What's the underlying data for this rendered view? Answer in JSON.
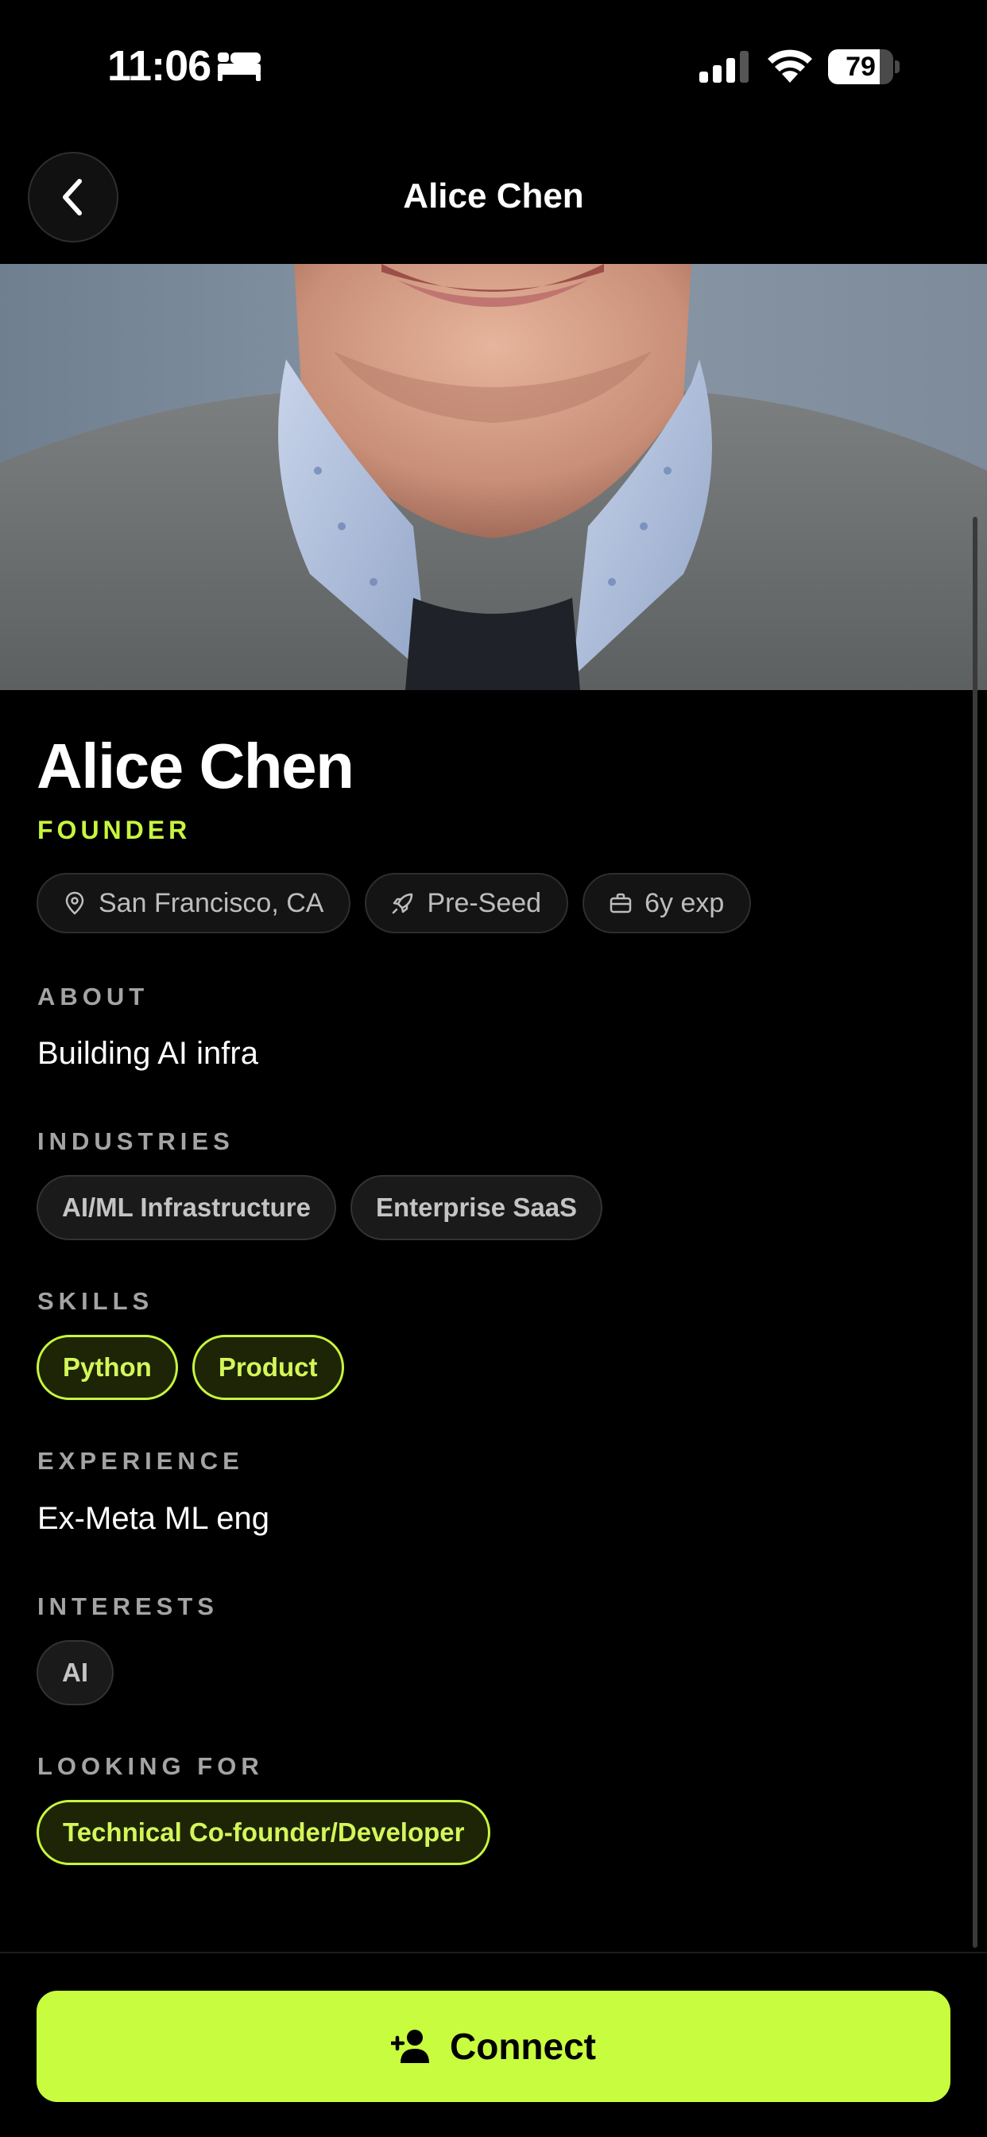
{
  "status_bar": {
    "time": "11:06",
    "battery": "79",
    "battery_level": 0.79,
    "icons": [
      "sleep-focus-icon",
      "cellular-signal-icon",
      "wifi-icon",
      "battery-icon"
    ]
  },
  "nav": {
    "title": "Alice Chen",
    "back_icon": "chevron-left-icon"
  },
  "profile": {
    "name": "Alice Chen",
    "role": "FOUNDER",
    "meta": [
      {
        "icon": "location-pin-icon",
        "label": "San Francisco, CA"
      },
      {
        "icon": "rocket-icon",
        "label": "Pre-Seed"
      },
      {
        "icon": "briefcase-icon",
        "label": "6y exp"
      }
    ],
    "about": {
      "label": "ABOUT",
      "text": "Building AI infra"
    },
    "industries": {
      "label": "INDUSTRIES",
      "items": [
        "AI/ML Infrastructure",
        "Enterprise SaaS"
      ]
    },
    "skills": {
      "label": "SKILLS",
      "items": [
        "Python",
        "Product"
      ]
    },
    "experience": {
      "label": "EXPERIENCE",
      "text": "Ex-Meta ML eng"
    },
    "interests": {
      "label": "INTERESTS",
      "items": [
        "AI"
      ]
    },
    "looking_for": {
      "label": "LOOKING FOR",
      "items": [
        "Technical Co-founder/Developer"
      ]
    }
  },
  "connect": {
    "label": "Connect",
    "icon": "add-person-icon"
  },
  "colors": {
    "accent": "#c8f53f",
    "background": "#000000",
    "chip_background": "#1a1a1a",
    "muted_text": "#a4a4a4"
  }
}
